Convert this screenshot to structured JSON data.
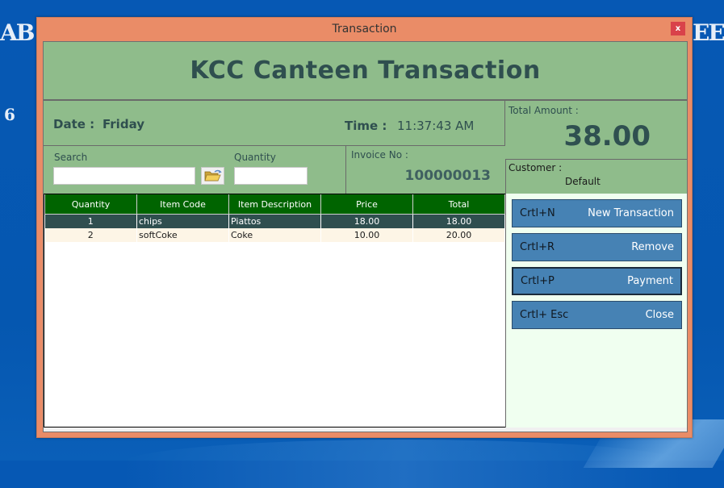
{
  "desktop": {
    "bg_text_left": "AB",
    "bg_text_right": "EE",
    "bg_text_number": "6"
  },
  "window": {
    "title": "Transaction",
    "close_label": "x",
    "accent_color": "#ea8c67"
  },
  "header": {
    "title": "KCC Canteen Transaction"
  },
  "info": {
    "date_label": "Date :",
    "date_value": "Friday",
    "time_label": "Time :",
    "time_value": "11:37:43 AM",
    "total_label": "Total Amount :",
    "total_value": "38.00",
    "invoice_label": "Invoice No :",
    "invoice_value": "100000013",
    "customer_label": "Customer :",
    "customer_value": "Default"
  },
  "search": {
    "search_label": "Search",
    "search_value": "",
    "quantity_label": "Quantity",
    "quantity_value": "",
    "browse_icon": "open-folder-icon"
  },
  "grid": {
    "columns": [
      "Quantity",
      "Item Code",
      "Item Description",
      "Price",
      "Total"
    ],
    "rows": [
      {
        "quantity": "1",
        "item_code": "chips",
        "description": "Piattos",
        "price": "18.00",
        "total": "18.00",
        "selected": true
      },
      {
        "quantity": "2",
        "item_code": "softCoke",
        "description": "Coke",
        "price": "10.00",
        "total": "20.00",
        "selected": false
      }
    ]
  },
  "actions": [
    {
      "shortcut": "Crtl+N",
      "label": "New Transaction"
    },
    {
      "shortcut": "Crtl+R",
      "label": "Remove"
    },
    {
      "shortcut": "Crtl+P",
      "label": "Payment"
    },
    {
      "shortcut": "Crtl+ Esc",
      "label": "Close"
    }
  ]
}
